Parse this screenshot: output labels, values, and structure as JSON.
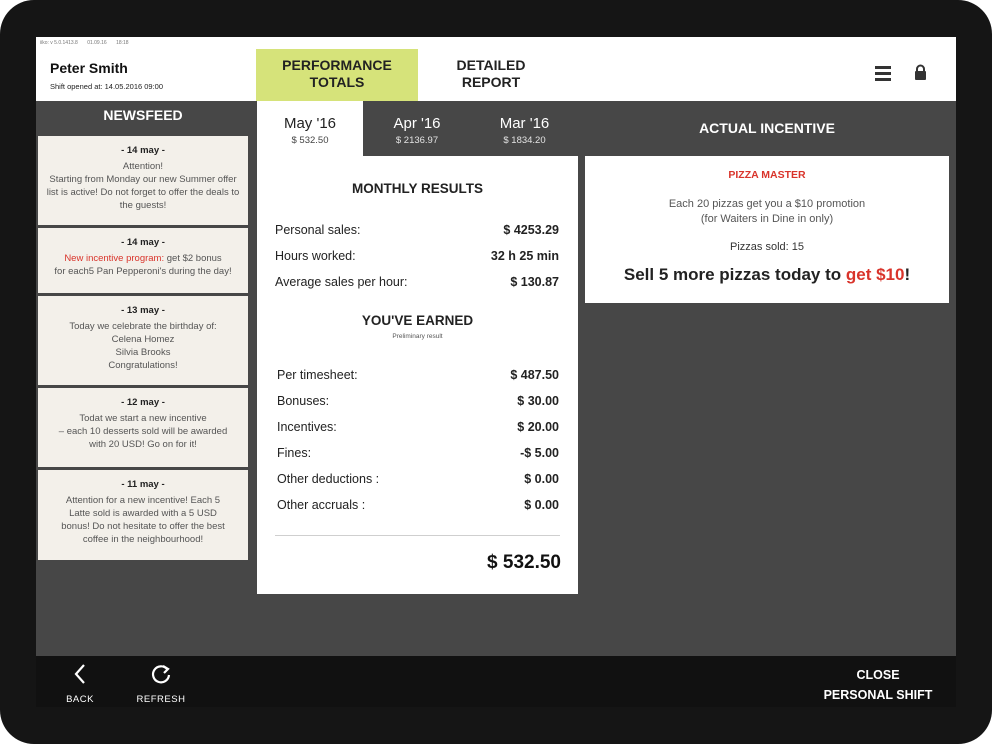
{
  "status_bar": {
    "version": "iiko: v 5.0.1413.8",
    "date": "01.09.16",
    "time": "18:18"
  },
  "header": {
    "user_name": "Peter Smith",
    "shift_opened": "Shift opened at: 14.05.2016 09:00",
    "tabs": [
      {
        "line1": "PERFORMANCE",
        "line2": "TOTALS",
        "active": true
      },
      {
        "line1": "DETAILED",
        "line2": "REPORT",
        "active": false
      }
    ],
    "menu_icon": "hamburger-menu-icon",
    "lock_icon": "lock-icon"
  },
  "newsfeed": {
    "title": "NEWSFEED",
    "items": [
      {
        "date": "- 14 may -",
        "lines": [
          "Attention!",
          "Starting from Monday our new Summer offer",
          "list is active! Do not forget to offer the deals to",
          "the guests!"
        ]
      },
      {
        "date": "- 14 may -",
        "highlight": "New incentive program:",
        "lines": [
          " get $2 bonus",
          "for each5 Pan Pepperoni's during the day!"
        ]
      },
      {
        "date": "- 13 may -",
        "lines": [
          "Today we celebrate the birthday of:",
          "Celena Homez",
          "Silvia Brooks",
          "Congratulations!"
        ]
      },
      {
        "date": "- 12 may -",
        "lines": [
          "Todat we start a new incentive",
          "– each 10 desserts sold will be awarded",
          "with 20 USD! Go on for it!"
        ]
      },
      {
        "date": "- 11 may -",
        "lines": [
          "Attention for a new incentive! Each 5",
          "Latte sold is awarded with a 5 USD",
          "bonus! Do not hesitate to offer the best",
          "coffee in the neighbourhood!"
        ]
      }
    ]
  },
  "months": [
    {
      "name": "May '16",
      "total": "$ 532.50",
      "active": true
    },
    {
      "name": "Apr '16",
      "total": "$ 2136.97",
      "active": false
    },
    {
      "name": "Mar '16",
      "total": "$ 1834.20",
      "active": false
    }
  ],
  "monthly_results": {
    "title": "MONTHLY RESULTS",
    "rows": [
      {
        "label": "Personal sales:",
        "value": "$ 4253.29"
      },
      {
        "label": "Hours worked:",
        "value": "32 h 25 min"
      },
      {
        "label": "Average sales per hour:",
        "value": "$ 130.87"
      }
    ]
  },
  "earned": {
    "title": "YOU'VE EARNED",
    "subtitle": "Preliminary result",
    "rows": [
      {
        "label": "Per timesheet:",
        "value": "$ 487.50"
      },
      {
        "label": "Bonuses:",
        "value": "$ 30.00"
      },
      {
        "label": "Incentives:",
        "value": "$ 20.00"
      },
      {
        "label": "Fines:",
        "value": "-$ 5.00"
      },
      {
        "label": "Other deductions :",
        "value": "$ 0.00"
      },
      {
        "label": "Other accruals :",
        "value": "$ 0.00"
      }
    ],
    "total": "$ 532.50"
  },
  "incentive": {
    "title": "ACTUAL INCENTIVE",
    "name": "PIZZA MASTER",
    "desc_line1": "Each 20 pizzas get you a $10 promotion",
    "desc_line2": "(for Waiters in Dine in only)",
    "sold": "Pizzas sold: 15",
    "call_text": "Sell 5 more pizzas today to ",
    "call_highlight": "get $10",
    "call_end": "!"
  },
  "footer": {
    "back_label": "BACK",
    "back_icon": "chevron-left-icon",
    "refresh_label": "REFRESH",
    "refresh_icon": "refresh-icon",
    "close_line1": "CLOSE",
    "close_line2": "PERSONAL SHIFT"
  },
  "colors": {
    "accent_tab": "#d6e37a",
    "highlight_red": "#d9342b",
    "background": "#474747",
    "bottom_bar": "#111111"
  }
}
